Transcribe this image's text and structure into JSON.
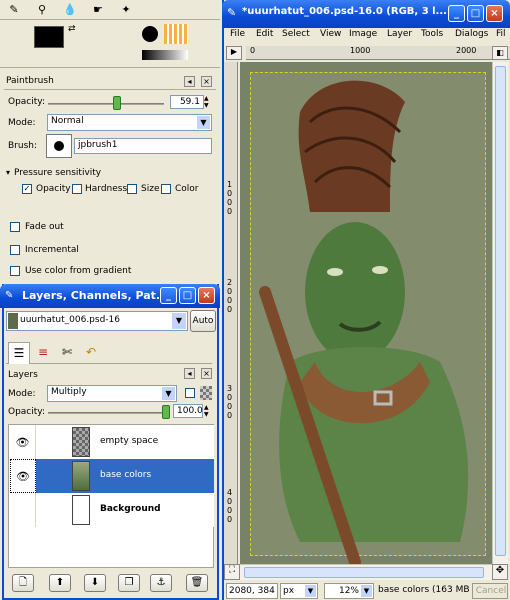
{
  "paintbrush": {
    "title": "Paintbrush",
    "opacity_label": "Opacity:",
    "opacity_value": "59.1",
    "opacity_fraction": 0.591,
    "mode_label": "Mode:",
    "mode_value": "Normal",
    "brush_label": "Brush:",
    "brush_value": "jpbrush1",
    "pressure_label": "Pressure sensitivity",
    "pressure_opacity": "Opacity",
    "pressure_hardness": "Hardness",
    "pressure_size": "Size",
    "pressure_color": "Color",
    "fade_out": "Fade out",
    "incremental": "Incremental",
    "use_gradient": "Use color from gradient"
  },
  "layers_window": {
    "title": "Layers, Channels, Pat...",
    "image_select": "uuurhatut_006.psd-16",
    "auto_label": "Auto",
    "panel_title": "Layers",
    "mode_label": "Mode:",
    "mode_value": "Multiply",
    "opacity_label": "Opacity:",
    "opacity_value": "100.0",
    "opacity_fraction": 1.0,
    "layers": [
      {
        "name": "empty space",
        "selected": false
      },
      {
        "name": "base colors",
        "selected": true
      },
      {
        "name": "Background",
        "selected": false
      }
    ]
  },
  "image_window": {
    "title": "*uuurhatut_006.psd-16.0 (RGB, 3 l...",
    "menus": [
      "File",
      "Edit",
      "Select",
      "View",
      "Image",
      "Layer",
      "Tools",
      "Dialogs",
      "Fil"
    ],
    "ruler_h": [
      "0",
      "1000",
      "2000"
    ],
    "ruler_v": [
      "1000",
      "2000",
      "3000",
      "4000"
    ],
    "coords": "2080, 384",
    "unit": "px",
    "zoom": "12%",
    "status": "base colors (163 MB)",
    "cancel": "Cancel"
  },
  "colors": {
    "accent": "#0a4bd6",
    "selection": "#316ac5",
    "canvas_bg": "#788266"
  }
}
